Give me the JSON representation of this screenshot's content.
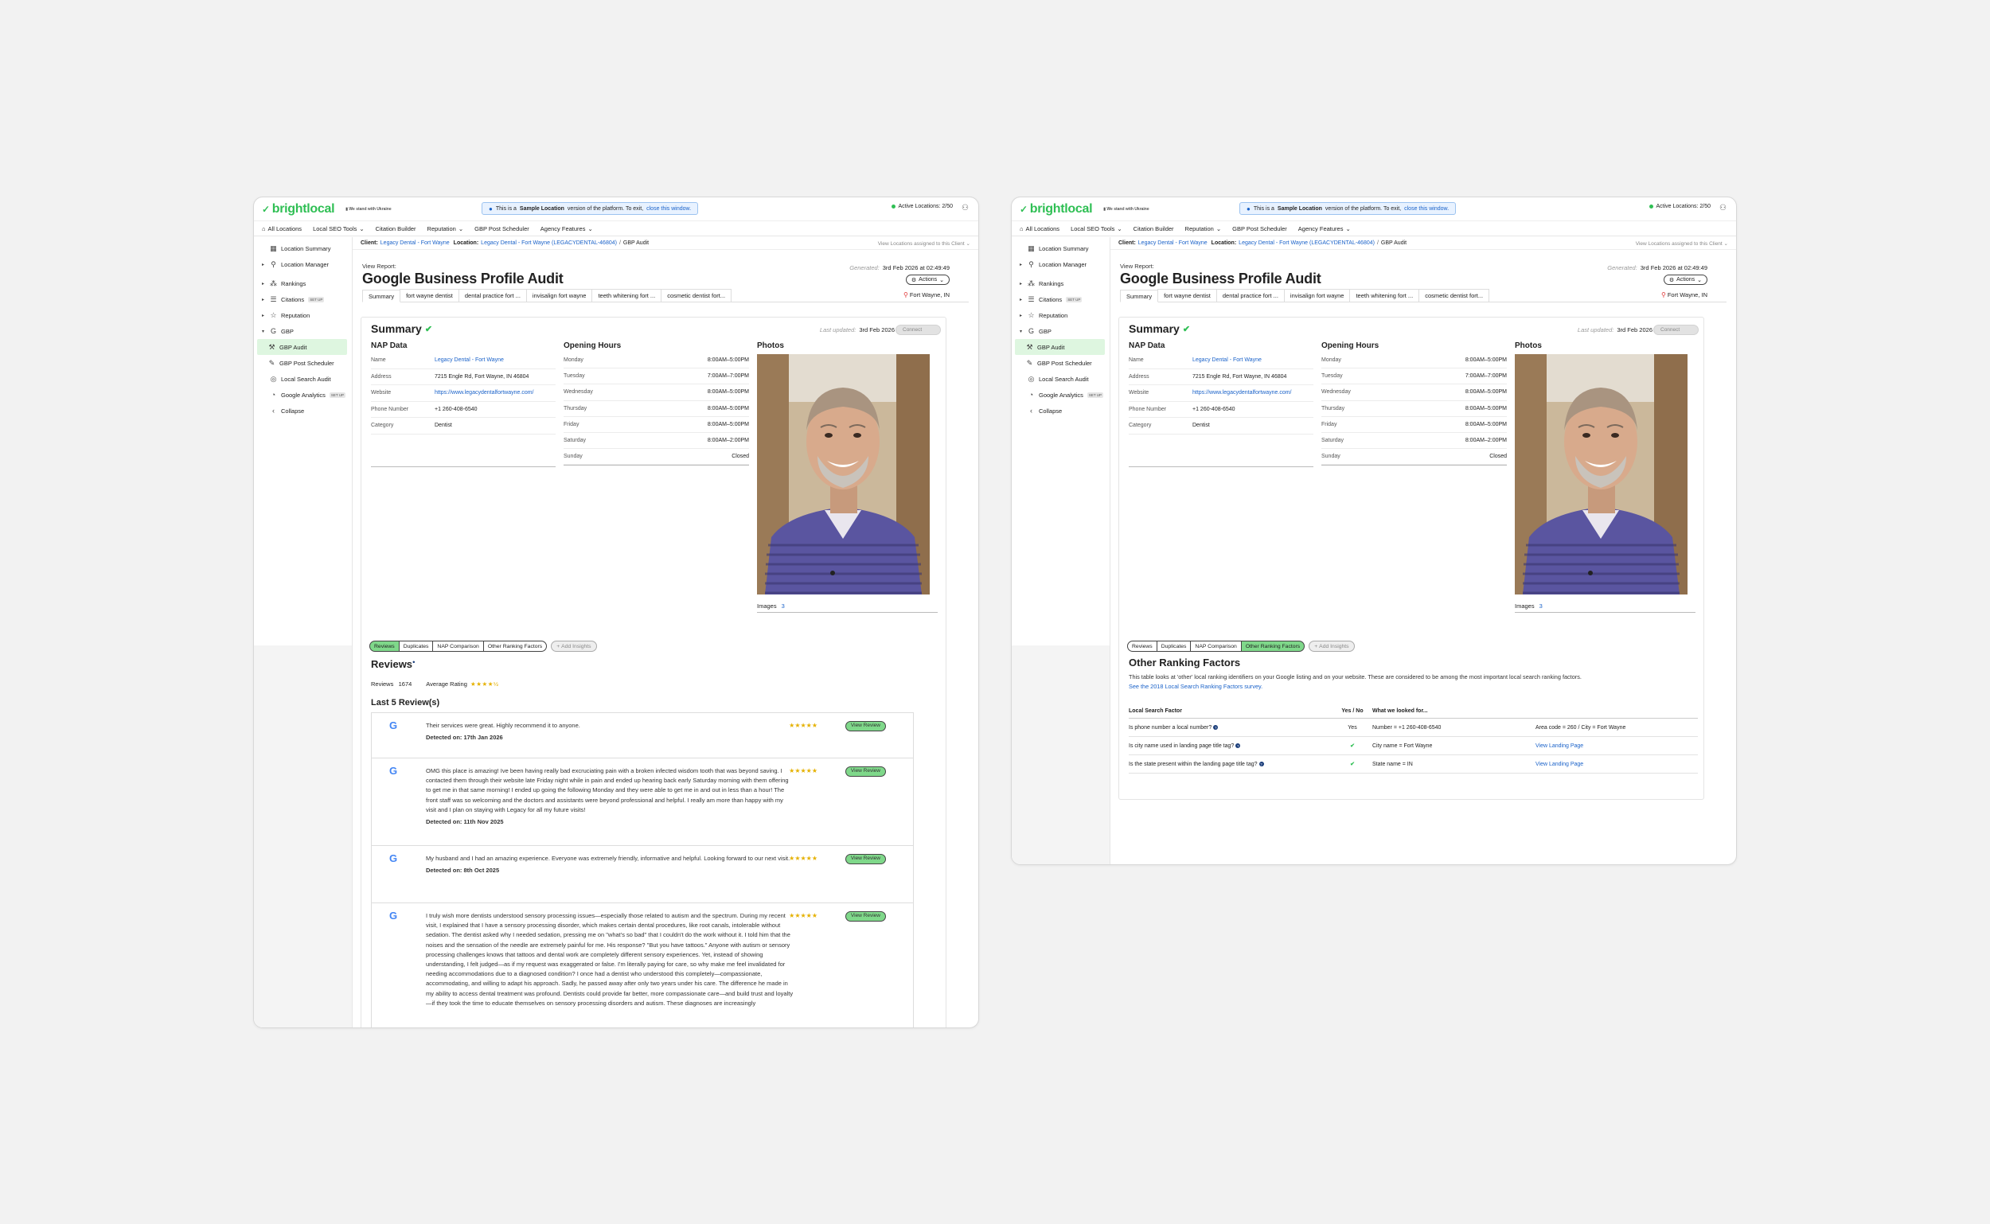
{
  "app": {
    "logo": "brightlocal",
    "stands_with": "We stand with Ukraine",
    "banner_prefix": "This is a",
    "banner_bold": "Sample Location",
    "banner_rest": "version of the platform. To exit,",
    "banner_link": "close this window.",
    "active_locations": "Active Locations: 2/50"
  },
  "nav": [
    "All Locations",
    "Local SEO Tools",
    "Citation Builder",
    "Reputation",
    "GBP Post Scheduler",
    "Agency Features"
  ],
  "sidebar": {
    "items": [
      "Location Summary",
      "Location Manager",
      "Rankings",
      "Citations",
      "Reputation",
      "GBP",
      "GBP Audit",
      "GBP Post Scheduler",
      "Local Search Audit",
      "Google Analytics",
      "Collapse"
    ],
    "setup_badge": "SET UP"
  },
  "breadcrumb": {
    "client_label": "Client:",
    "client": "Legacy Dental - Fort Wayne",
    "location_label": "Location:",
    "location": "Legacy Dental - Fort Wayne (LEGACYDENTAL-46804)",
    "page": "GBP Audit",
    "right": "View Locations assigned to this Client"
  },
  "report": {
    "view_report": "View Report:",
    "title": "Google Business Profile Audit",
    "generated_label": "Generated:",
    "generated": "3rd Feb 2026 at 02:49:49",
    "actions": "Actions"
  },
  "tabs": [
    "Summary",
    "fort wayne dentist",
    "dental practice fort ...",
    "invisalign fort wayne",
    "teeth whitening fort ...",
    "cosmetic dentist fort..."
  ],
  "tab_location": "Fort Wayne, IN",
  "summary": {
    "title": "Summary",
    "last_updated_label": "Last updated:",
    "last_updated": "3rd Feb 2026",
    "connect": "Connect",
    "nap_title": "NAP Data",
    "nap": [
      {
        "k": "Name",
        "v": "Legacy Dental - Fort Wayne"
      },
      {
        "k": "Address",
        "v": "7215 Engle Rd, Fort Wayne, IN 46804"
      },
      {
        "k": "Website",
        "v": "https://www.legacydentalfortwayne.com/"
      },
      {
        "k": "Phone Number",
        "v": "+1 260-408-6540"
      },
      {
        "k": "Category",
        "v": "Dentist"
      }
    ],
    "hours_title": "Opening Hours",
    "hours": [
      {
        "d": "Monday",
        "h": "8:00AM–5:00PM"
      },
      {
        "d": "Tuesday",
        "h": "7:00AM–7:00PM"
      },
      {
        "d": "Wednesday",
        "h": "8:00AM–5:00PM"
      },
      {
        "d": "Thursday",
        "h": "8:00AM–5:00PM"
      },
      {
        "d": "Friday",
        "h": "8:00AM–5:00PM"
      },
      {
        "d": "Saturday",
        "h": "8:00AM–2:00PM"
      },
      {
        "d": "Sunday",
        "h": "Closed"
      }
    ],
    "photos_title": "Photos",
    "images_label": "Images",
    "images_count": "3"
  },
  "insight_tabs": [
    "Reviews",
    "Duplicates",
    "NAP Comparison",
    "Other Ranking Factors"
  ],
  "add_insights": "Add Insights",
  "reviews": {
    "title": "Reviews",
    "count_label": "Reviews",
    "count": "1674",
    "avg_label": "Average Rating",
    "avg_stars": "★★★★½",
    "last5": "Last 5 Review(s)",
    "view_review": "View Review",
    "five_stars": "★★★★★",
    "google_mark": "G",
    "items": [
      {
        "text": "Their services were great. Highly recommend it to anyone.",
        "date": "Detected on: 17th Jan 2026"
      },
      {
        "text": "OMG this place is amazing! Ive been having really bad excruciating pain with a broken infected wisdom tooth that was beyond saving. I contacted them through their website late Friday night while in pain and ended up hearing back early Saturday morning with them offering to get me in that same morning! I ended up going the following Monday and they were able to get me in and out in less than a hour! The front staff was so welcoming and the doctors and assistants were beyond professional and helpful. I really am more than happy with my visit and I plan on staying with Legacy for all my future visits!",
        "date": "Detected on: 11th Nov 2025"
      },
      {
        "text": "My husband and I had an amazing experience. Everyone was extremely friendly, informative and helpful. Looking forward to our next visit.",
        "date": "Detected on: 8th Oct 2025"
      },
      {
        "text": "I truly wish more dentists understood sensory processing issues—especially those related to autism and the spectrum. During my recent visit, I explained that I have a sensory processing disorder, which makes certain dental procedures, like root canals, intolerable without sedation. The dentist asked why I needed sedation, pressing me on \"what's so bad\" that I couldn't do the work without it. I told him that the noises and the sensation of the needle are extremely painful for me. His response? \"But you have tattoos.\" Anyone with autism or sensory processing challenges knows that tattoos and dental work are completely different sensory experiences. Yet, instead of showing understanding, I felt judged—as if my request was exaggerated or false. I'm literally paying for care, so why make me feel invalidated for needing accommodations due to a diagnosed condition? I once had a dentist who understood this completely—compassionate, accommodating, and willing to adapt his approach. Sadly, he passed away after only two years under his care. The difference he made in my ability to access dental treatment was profound. Dentists could provide far better, more compassionate care—and build trust and loyalty—if they took the time to educate themselves on sensory processing disorders and autism. These diagnoses are increasingly",
        "date": ""
      }
    ]
  },
  "orf": {
    "title": "Other Ranking Factors",
    "desc": "This table looks at 'other' local ranking identifiers on your Google listing and on your website. These are considered to be among the most important local search ranking factors.",
    "link": "See the 2018 Local Search Ranking Factors survey.",
    "headers": [
      "Local Search Factor",
      "Yes / No",
      "What we looked for..."
    ],
    "rows": [
      {
        "factor": "Is phone number a local number?",
        "yn": "Yes",
        "looked": "Number = +1 260-408-6540",
        "extra": "Area code = 260 / City = Fort Wayne"
      },
      {
        "factor": "Is city name used in landing page title tag?",
        "yn": "✔",
        "looked": "City name = Fort Wayne",
        "extra": "View Landing Page"
      },
      {
        "factor": "Is the state present within the landing page title tag?",
        "yn": "✔",
        "looked": "State name = IN",
        "extra": "View Landing Page"
      }
    ]
  }
}
